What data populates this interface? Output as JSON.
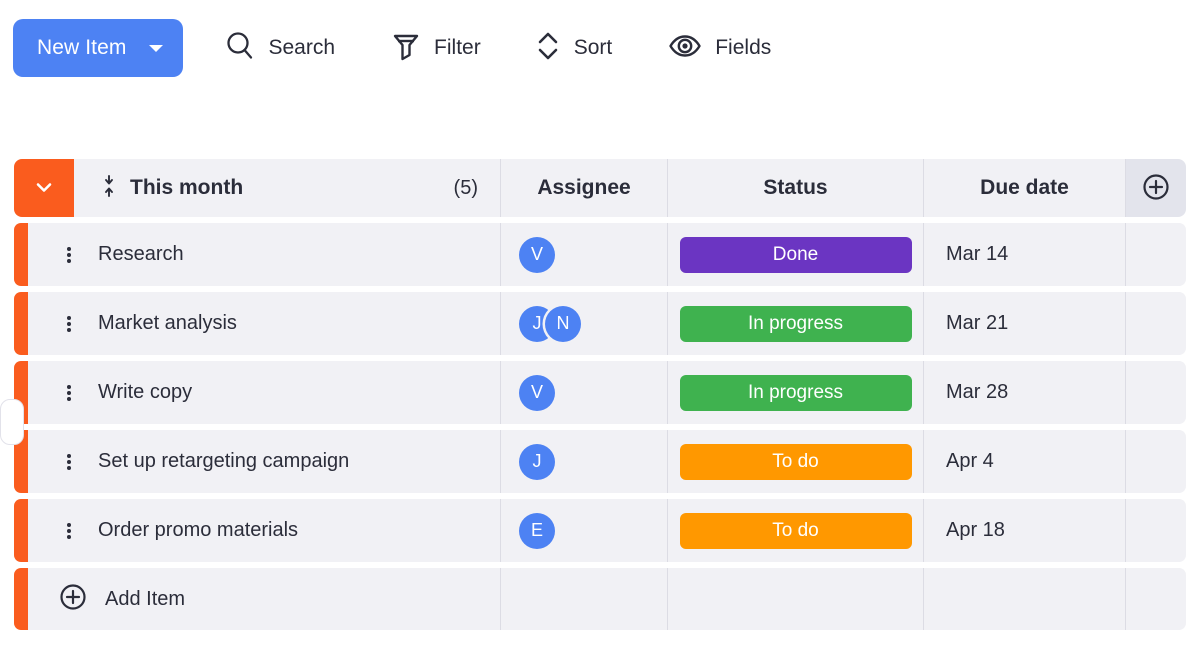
{
  "toolbar": {
    "new_item": {
      "label": "New Item",
      "icon": "caret-down-icon",
      "color": "#4d82f3"
    },
    "actions": [
      {
        "id": "search",
        "label": "Search",
        "icon": "search-icon"
      },
      {
        "id": "filter",
        "label": "Filter",
        "icon": "filter-funnel-icon"
      },
      {
        "id": "sort",
        "label": "Sort",
        "icon": "sort-updown-icon"
      },
      {
        "id": "fields",
        "label": "Fields",
        "icon": "eye-icon"
      }
    ]
  },
  "table": {
    "group": {
      "title": "This month",
      "count": "(5)",
      "collapse_icon": "chevron-down-icon",
      "drag_icon": "collapse-arrows-icon",
      "accent_color": "#fa5c1e"
    },
    "columns": [
      {
        "id": "assignee",
        "label": "Assignee"
      },
      {
        "id": "status",
        "label": "Status"
      },
      {
        "id": "duedate",
        "label": "Due date"
      }
    ],
    "add_column_icon": "plus-circle-icon",
    "rows": [
      {
        "name": "Research",
        "assignees": [
          "V"
        ],
        "status": {
          "label": "Done",
          "color": "#6b35c2",
          "variant": "done"
        },
        "due_date": "Mar 14"
      },
      {
        "name": "Market analysis",
        "assignees": [
          "J",
          "N"
        ],
        "status": {
          "label": "In progress",
          "color": "#3fb24f",
          "variant": "progress"
        },
        "due_date": "Mar 21"
      },
      {
        "name": "Write copy",
        "assignees": [
          "V"
        ],
        "status": {
          "label": "In progress",
          "color": "#3fb24f",
          "variant": "progress"
        },
        "due_date": "Mar 28"
      },
      {
        "name": "Set up retargeting campaign",
        "assignees": [
          "J"
        ],
        "status": {
          "label": "To do",
          "color": "#ff9800",
          "variant": "todo"
        },
        "due_date": "Apr 4"
      },
      {
        "name": "Order promo materials",
        "assignees": [
          "E"
        ],
        "status": {
          "label": "To do",
          "color": "#ff9800",
          "variant": "todo"
        },
        "due_date": "Apr 18"
      }
    ],
    "add_item": {
      "label": "Add Item",
      "icon": "plus-circle-icon"
    }
  }
}
